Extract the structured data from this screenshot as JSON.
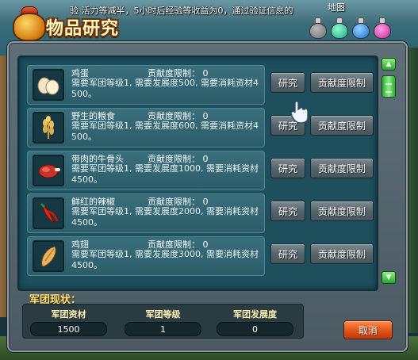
{
  "marquee": "验  活力等减半，5小时后经验等收益为0，通过验证信息的",
  "map_label": "地图",
  "window": {
    "title": "物品研究"
  },
  "items": [
    {
      "name": "鸡蛋",
      "contrib_limit": "贡献度限制：  0",
      "desc": "需要军团等级1, 需要发展度500, 需要消耗资材4500。",
      "icon": "egg-icon",
      "research_label": "研究",
      "contrib_label": "贡献度限制"
    },
    {
      "name": "野生的粮食",
      "contrib_limit": "贡献度限制：  0",
      "desc": "需要军团等级1, 需要发展度600, 需要消耗资材4500。",
      "icon": "grain-icon",
      "research_label": "研究",
      "contrib_label": "贡献度限制"
    },
    {
      "name": "带肉的牛骨头",
      "contrib_limit": "贡献度限制：  0",
      "desc": "需要军团等级1, 需要发展度1000, 需要消耗资材4500。",
      "icon": "meat-icon",
      "research_label": "研究",
      "contrib_label": "贡献度限制"
    },
    {
      "name": "鲜红的辣椒",
      "contrib_limit": "贡献度限制：  0",
      "desc": "需要军团等级1, 需要发展度2000, 需要消耗资材4500。",
      "icon": "chili-icon",
      "research_label": "研究",
      "contrib_label": "贡献度限制"
    },
    {
      "name": "鸡翅",
      "contrib_limit": "贡献度限制：  0",
      "desc": "需要军团等级1, 需要发展度3000, 需要消耗资材4500。",
      "icon": "chicken-wing-icon",
      "research_label": "研究",
      "contrib_label": "贡献度限制"
    }
  ],
  "status": {
    "title": "军团现状：",
    "headers": [
      "军团资材",
      "军团等级",
      "军团发展度"
    ],
    "values": [
      "1500",
      "1",
      "0"
    ]
  },
  "cancel_label": "取消",
  "colors": {
    "accent_green": "#28a631",
    "cancel_orange": "#e2531c",
    "title_cream": "#fff7c4"
  }
}
